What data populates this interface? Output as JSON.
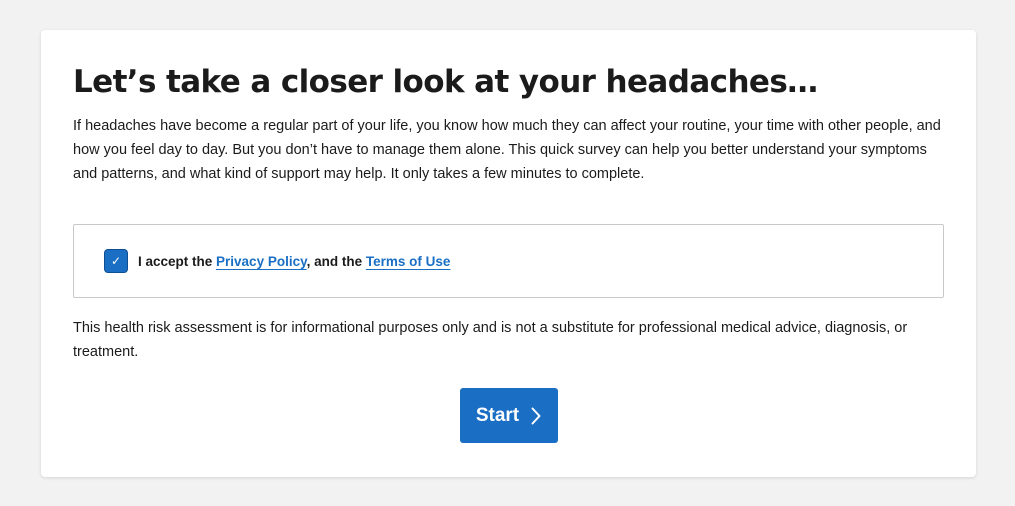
{
  "intro": {
    "title": "Let’s take a closer look at your headaches…",
    "body": "If headaches have become a regular part of your life, you know how much they can affect your routine, your time with other people, and how you feel day to day. But you don’t have to manage them alone. This quick survey can help you better understand your symptoms and patterns, and what kind of support may help. It only takes a few minutes to complete."
  },
  "consent": {
    "checked": true,
    "check_glyph": "✓",
    "prefix": "I accept the ",
    "privacy_link": "Privacy Policy",
    "middle": ", and the ",
    "terms_link": "Terms of Use"
  },
  "disclaimer": "This health risk assessment is for informational purposes only and is not a substitute for professional medical advice, diagnosis, or treatment.",
  "start_button": {
    "label": "Start",
    "icon": "chevron-right-icon"
  },
  "colors": {
    "accent": "#1a6fc4",
    "background": "#f2f2f2",
    "card": "#ffffff",
    "text": "#1b1b1b"
  }
}
